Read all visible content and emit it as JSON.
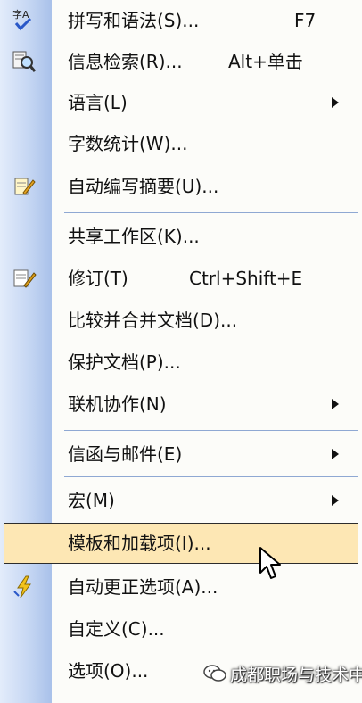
{
  "menu": {
    "items": [
      {
        "id": "spelling",
        "label": "拼写和语法(S)...",
        "shortcut": "F7",
        "icon": "spell-check-icon"
      },
      {
        "id": "research",
        "label": "信息检索(R)...",
        "shortcut": "Alt+单击",
        "icon": "research-icon"
      },
      {
        "id": "language",
        "label": "语言(L)",
        "submenu": true
      },
      {
        "id": "word-count",
        "label": "字数统计(W)..."
      },
      {
        "id": "autosummarize",
        "label": "自动编写摘要(U)...",
        "icon": "autosummarize-icon"
      },
      {
        "id": "shared-workspace",
        "label": "共享工作区(K)..."
      },
      {
        "id": "track-changes",
        "label": "修订(T)",
        "shortcut": "Ctrl+Shift+E",
        "icon": "track-changes-icon"
      },
      {
        "id": "compare-merge",
        "label": "比较并合并文档(D)..."
      },
      {
        "id": "protect-document",
        "label": "保护文档(P)..."
      },
      {
        "id": "online-collaboration",
        "label": "联机协作(N)",
        "submenu": true
      },
      {
        "id": "letters-mailings",
        "label": "信函与邮件(E)",
        "submenu": true
      },
      {
        "id": "macro",
        "label": "宏(M)",
        "submenu": true
      },
      {
        "id": "templates-addins",
        "label": "模板和加载项(I)...",
        "highlighted": true
      },
      {
        "id": "autocorrect",
        "label": "自动更正选项(A)...",
        "icon": "autocorrect-icon"
      },
      {
        "id": "customize",
        "label": "自定义(C)..."
      },
      {
        "id": "options",
        "label": "选项(O)..."
      }
    ]
  },
  "watermark": {
    "text": "成都职场与技术中心",
    "icon": "wechat-icon"
  },
  "colors": {
    "gutter": "#c6d7f3",
    "highlight": "#fde7b4",
    "separator": "#8fa8d3"
  }
}
